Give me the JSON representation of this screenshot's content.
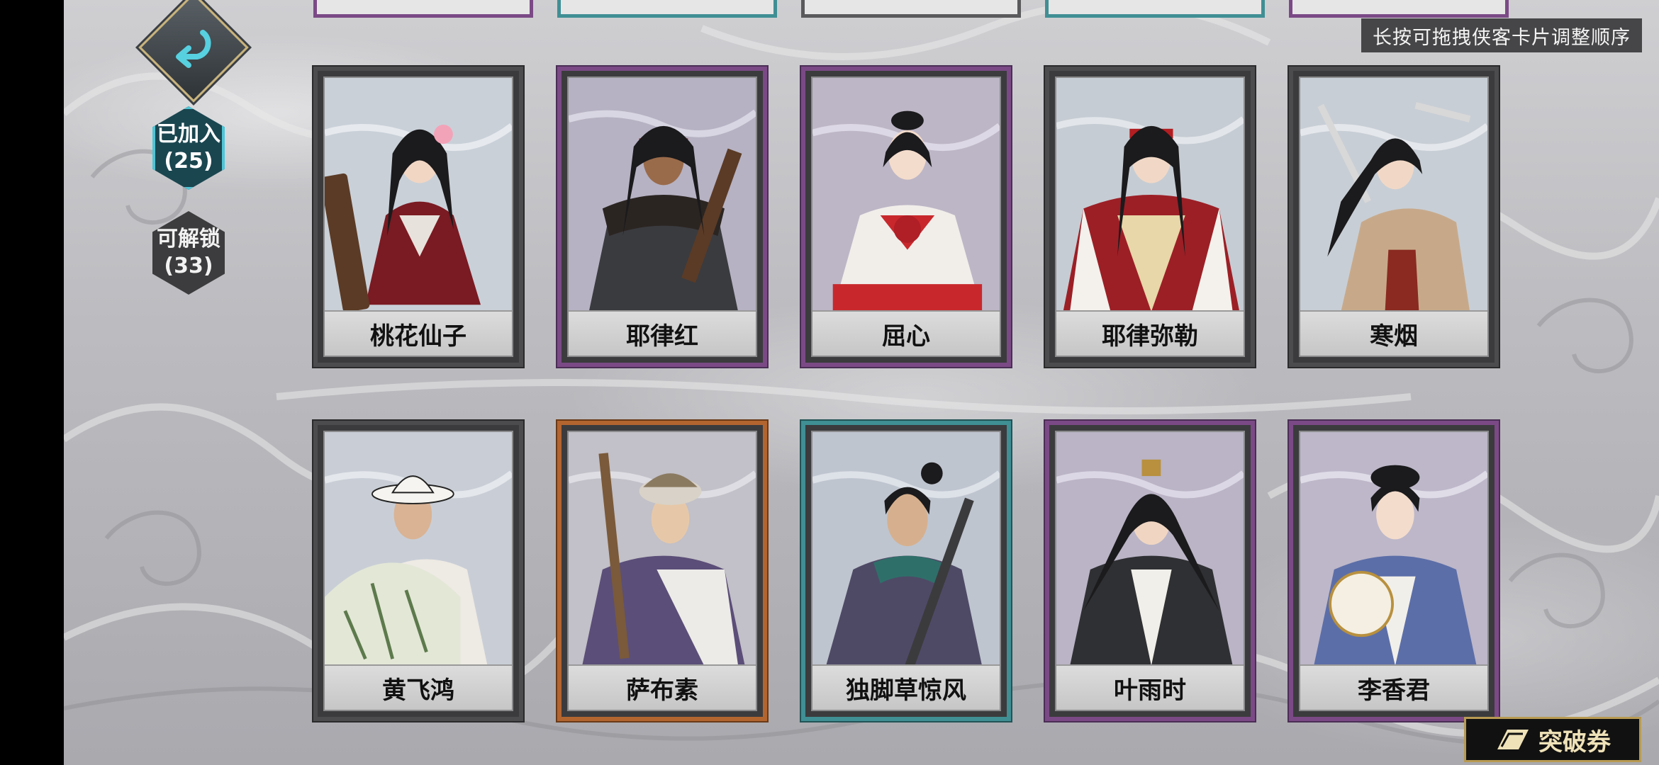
{
  "hint_text": "长按可拖拽侠客卡片调整顺序",
  "filters": [
    {
      "label": "已加入",
      "count": "(25)",
      "active": true
    },
    {
      "label": "可解锁",
      "count": "(33)",
      "active": false
    }
  ],
  "cards_row1": [
    {
      "name": "桃花仙子",
      "rarity": "gray"
    },
    {
      "name": "耶律红",
      "rarity": "purple"
    },
    {
      "name": "屈心",
      "rarity": "purple"
    },
    {
      "name": "耶律弥勒",
      "rarity": "gray"
    },
    {
      "name": "寒烟",
      "rarity": "gray"
    }
  ],
  "cards_row2": [
    {
      "name": "黄飞鸿",
      "rarity": "gray"
    },
    {
      "name": "萨布素",
      "rarity": "orange"
    },
    {
      "name": "独脚草惊风",
      "rarity": "teal"
    },
    {
      "name": "叶雨时",
      "rarity": "purple"
    },
    {
      "name": "李香君",
      "rarity": "purple"
    }
  ],
  "voucher_label": "突破券",
  "icons": {
    "back": "return-arrow-icon",
    "voucher": "ticket-icon"
  },
  "colors": {
    "purple": "#7b4a86",
    "teal": "#3f8f94",
    "orange": "#b3652f",
    "gray": "#4c4c4e",
    "active_filter": "#4fc6d6"
  }
}
